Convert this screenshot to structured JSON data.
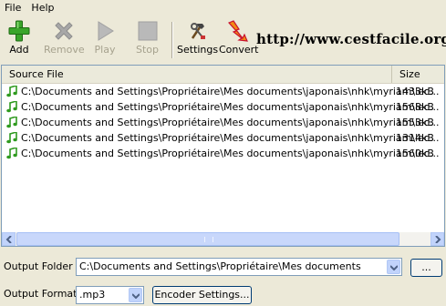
{
  "menu": {
    "file": "File",
    "help": "Help"
  },
  "toolbar": {
    "add": "Add",
    "remove": "Remove",
    "play": "Play",
    "stop": "Stop",
    "settings": "Settings",
    "convert": "Convert"
  },
  "watermark": "http://www.cestfacile.org",
  "list": {
    "columns": {
      "source": "Source File",
      "size": "Size"
    },
    "rows": [
      {
        "path": "C:\\Documents and Settings\\Propriétaire\\Mes documents\\japonais\\nhk\\myriam\\lec...",
        "size": "1433kB"
      },
      {
        "path": "C:\\Documents and Settings\\Propriétaire\\Mes documents\\japonais\\nhk\\myriam\\lec...",
        "size": "1568kB"
      },
      {
        "path": "C:\\Documents and Settings\\Propriétaire\\Mes documents\\japonais\\nhk\\myriam\\lec...",
        "size": "1553kB"
      },
      {
        "path": "C:\\Documents and Settings\\Propriétaire\\Mes documents\\japonais\\nhk\\myriam\\lec...",
        "size": "1314kB"
      },
      {
        "path": "C:\\Documents and Settings\\Propriétaire\\Mes documents\\japonais\\nhk\\myriam\\lec...",
        "size": "1560kB"
      }
    ]
  },
  "output": {
    "folder_label": "Output Folder",
    "folder_value": "C:\\Documents and Settings\\Propriétaire\\Mes documents",
    "browse_label": "...",
    "format_label": "Output Format",
    "format_value": ".mp3",
    "encoder_label": "Encoder Settings..."
  },
  "colors": {
    "window_bg": "#ece9d8",
    "accent_green": "#2f9a1f",
    "scroll_blue": "#c1d3fb",
    "disabled_gray": "#a6a28e"
  },
  "icons": [
    "add-icon",
    "remove-icon",
    "play-icon",
    "stop-icon",
    "settings-icon",
    "convert-icon",
    "music-note-icon"
  ]
}
